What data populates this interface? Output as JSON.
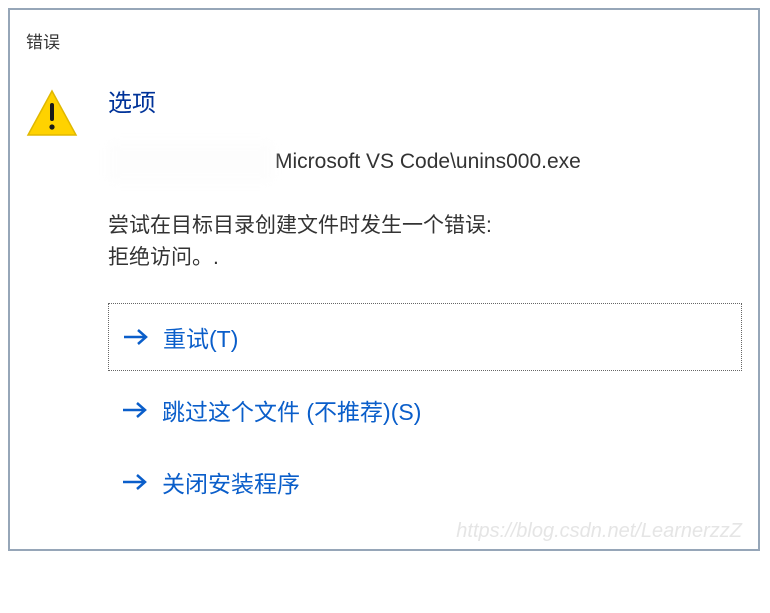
{
  "dialog": {
    "title": "错误",
    "section_header": "选项",
    "file_path": "Microsoft VS Code\\unins000.exe",
    "error_line1": "尝试在目标目录创建文件时发生一个错误:",
    "error_line2": "拒绝访问。.",
    "actions": {
      "retry": "重试(T)",
      "skip": "跳过这个文件 (不推荐)(S)",
      "close": "关闭安装程序"
    }
  },
  "watermark": "https://blog.csdn.net/LearnerzzZ"
}
